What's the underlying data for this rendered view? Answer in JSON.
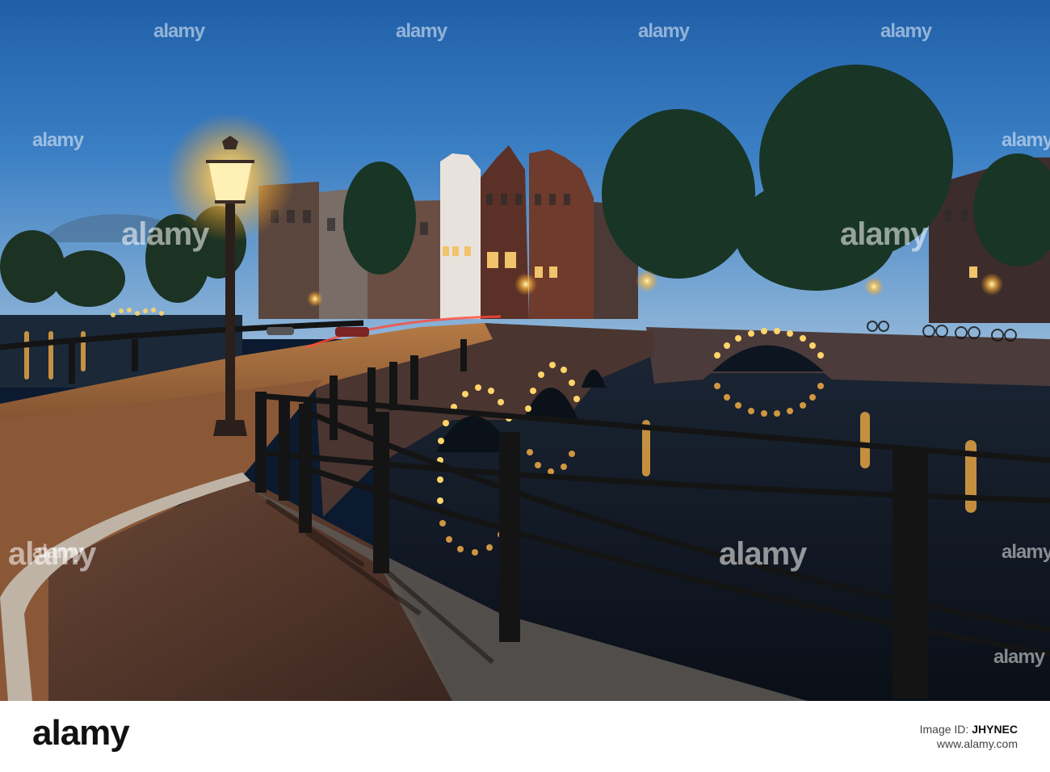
{
  "watermark": {
    "brand": "alamy"
  },
  "footer": {
    "logo": "alamy",
    "image_id_label": "Image ID:",
    "image_id": "JHYNEC",
    "site": "www.alamy.com"
  }
}
